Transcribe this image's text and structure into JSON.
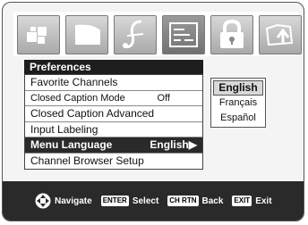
{
  "menu": {
    "title": "Preferences",
    "items": [
      {
        "label": "Favorite Channels",
        "value": ""
      },
      {
        "label": "Closed Caption Mode",
        "value": "Off"
      },
      {
        "label": "Closed Caption Advanced",
        "value": ""
      },
      {
        "label": "Input Labeling",
        "value": ""
      },
      {
        "label": "Menu Language",
        "value": "English▶",
        "selected": true
      },
      {
        "label": "Channel Browser Setup",
        "value": ""
      }
    ]
  },
  "language_options": [
    {
      "label": "English",
      "selected": true
    },
    {
      "label": "Français"
    },
    {
      "label": "Español"
    }
  ],
  "icons": [
    "picture-icon",
    "audio-icon",
    "music-icon",
    "setup-icon",
    "lock-icon",
    "applications-icon"
  ],
  "help_bar": {
    "navigate": "Navigate",
    "enter_key": "ENTER",
    "select": "Select",
    "chrtn_key": "CH RTN",
    "back": "Back",
    "exit_key": "EXIT",
    "exit": "Exit"
  }
}
